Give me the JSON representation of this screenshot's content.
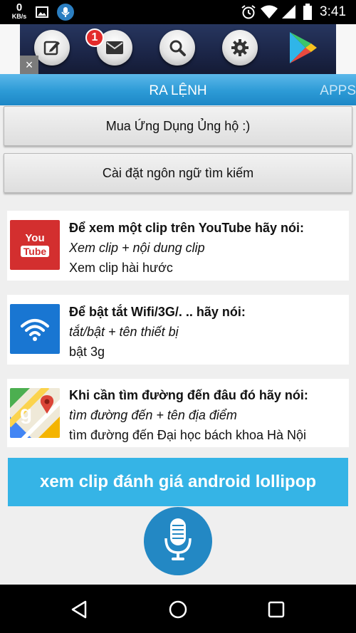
{
  "status_bar": {
    "speed_value": "0",
    "speed_unit": "KB/s",
    "time": "3:41",
    "icons": [
      "image-icon",
      "microphone-notification-icon",
      "alarm-icon",
      "wifi-icon",
      "signal-icon",
      "battery-icon"
    ]
  },
  "ad": {
    "icons": [
      "compose-icon",
      "mail-icon",
      "search-icon",
      "settings-icon",
      "play-store-icon"
    ],
    "mail_badge": "1",
    "close_label": "×"
  },
  "tabs": {
    "active": "RA LỆNH",
    "next": "APPS"
  },
  "buttons": {
    "buy_app": "Mua Ứng Dụng Ủng hộ :)",
    "search_language": "Cài đặt ngôn ngữ tìm kiếm"
  },
  "cards": [
    {
      "icon": "youtube-icon",
      "icon_line1": "You",
      "icon_line2": "Tube",
      "title": "Để xem một clip trên YouTube hãy nói:",
      "syntax": "Xem clip + nội dung clip",
      "example": "Xem clip hài hước"
    },
    {
      "icon": "wifi-icon",
      "title": "Để bật tắt Wifi/3G/. .. hãy nói:",
      "syntax": "tắt/bật + tên thiết bị",
      "example": "bật 3g"
    },
    {
      "icon": "maps-icon",
      "title": "Khi cần tìm đường đến đâu đó hãy nói:",
      "syntax": "tìm đường đến + tên địa điểm",
      "example": "tìm đường đến Đại học bách khoa Hà Nội"
    }
  ],
  "promo": {
    "label": "xem clip đánh giá android lollipop"
  },
  "mic": {
    "icon": "microphone-icon"
  },
  "nav": {
    "icons": [
      "back-icon",
      "home-icon",
      "recents-icon"
    ]
  },
  "colors": {
    "tab_blue": "#2c9ad6",
    "promo_blue": "#35b4e6",
    "mic_blue": "#2388c4",
    "youtube_red": "#d32f2f",
    "wifi_blue": "#1976d2"
  }
}
